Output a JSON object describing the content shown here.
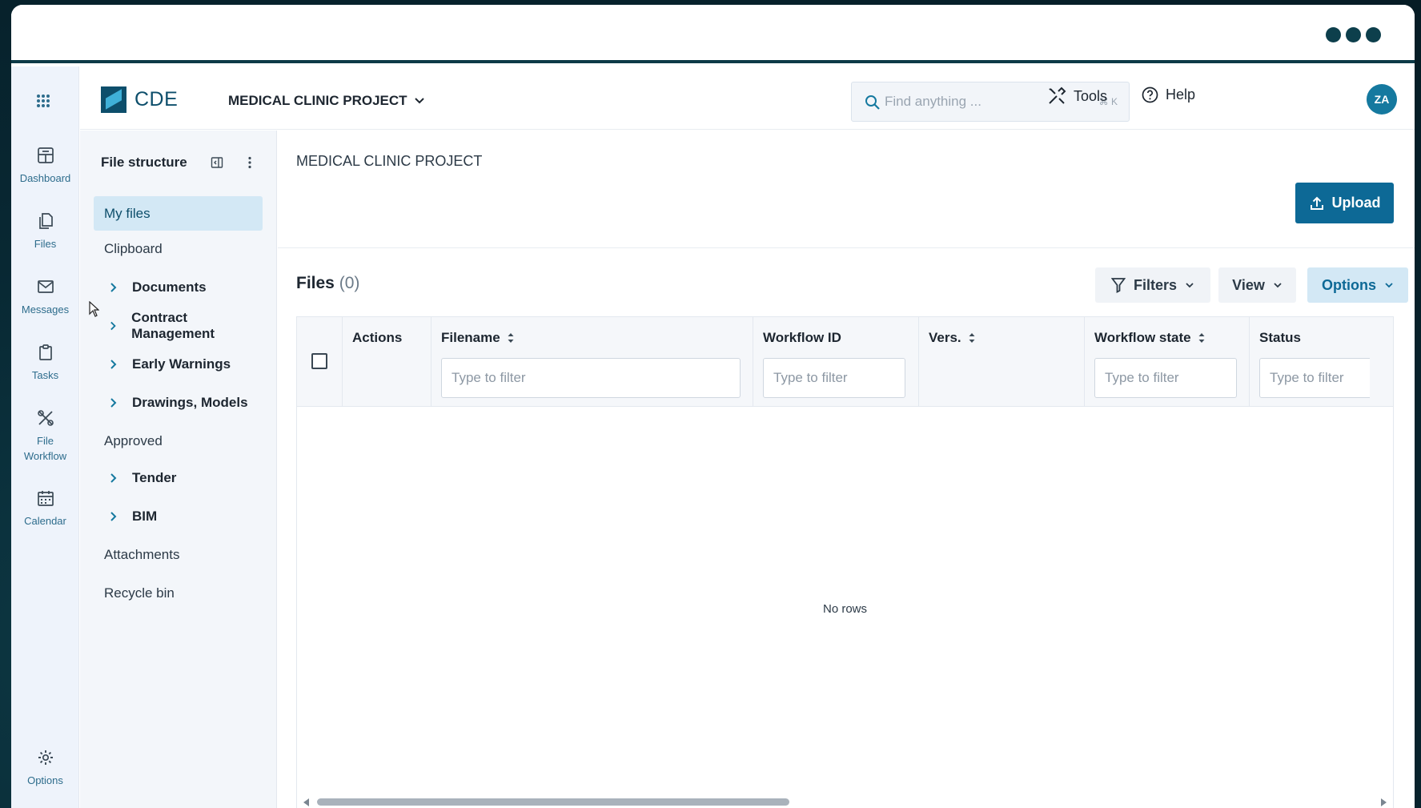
{
  "window": {
    "menu_icon": "more-dots-icon"
  },
  "rail": {
    "items": [
      {
        "label": "Dashboard",
        "icon": "dashboard-icon"
      },
      {
        "label": "Files",
        "icon": "files-icon"
      },
      {
        "label": "Messages",
        "icon": "mail-icon"
      },
      {
        "label": "Tasks",
        "icon": "clipboard-icon"
      },
      {
        "label": "File\nWorkflow",
        "label_line1": "File",
        "label_line2": "Workflow",
        "icon": "workflow-icon"
      },
      {
        "label": "Calendar",
        "icon": "calendar-icon"
      }
    ],
    "options_label": "Options"
  },
  "header": {
    "brand": "CDE",
    "project": "MEDICAL CLINIC PROJECT",
    "search_placeholder": "Find anything ...",
    "search_shortcut": "⌘ K",
    "tools_label": "Tools",
    "help_label": "Help",
    "avatar_initials": "ZA",
    "accent_color": "#15799f"
  },
  "tree": {
    "title": "File structure",
    "items": [
      {
        "label": "My files",
        "type": "root",
        "active": true
      },
      {
        "label": "Clipboard",
        "type": "root"
      },
      {
        "label": "Documents",
        "type": "folder"
      },
      {
        "label": "Contract Management",
        "type": "folder"
      },
      {
        "label": "Early Warnings",
        "type": "folder"
      },
      {
        "label": "Drawings, Models",
        "type": "folder"
      },
      {
        "label": "Approved",
        "type": "root"
      },
      {
        "label": "Tender",
        "type": "folder"
      },
      {
        "label": "BIM",
        "type": "folder"
      },
      {
        "label": "Attachments",
        "type": "root"
      },
      {
        "label": "Recycle bin",
        "type": "root"
      }
    ]
  },
  "main": {
    "title": "MEDICAL CLINIC PROJECT",
    "upload_label": "Upload",
    "files_label": "Files",
    "files_count": "(0)",
    "filters_label": "Filters",
    "view_label": "View",
    "options_label": "Options",
    "columns": {
      "actions": "Actions",
      "filename": "Filename",
      "workflow_id": "Workflow ID",
      "version": "Vers.",
      "workflow_state": "Workflow state",
      "status": "Status"
    },
    "filter_placeholder": "Type to filter",
    "empty_text": "No rows",
    "primary_color": "#0d6996"
  }
}
